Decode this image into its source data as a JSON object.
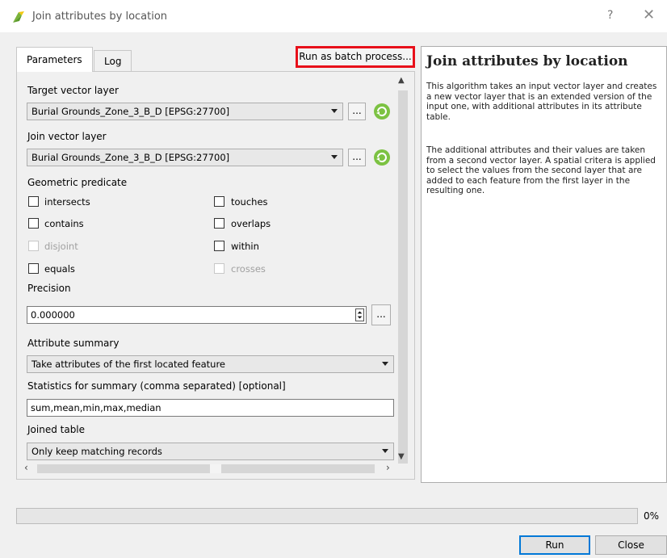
{
  "window": {
    "title": "Join attributes by location",
    "help_glyph": "?",
    "close_glyph": "✕"
  },
  "tabs": [
    {
      "label": "Parameters"
    },
    {
      "label": "Log"
    }
  ],
  "batch_button": "Run as batch process...",
  "params": {
    "target_label": "Target vector layer",
    "target_value": "Burial Grounds_Zone_3_B_D [EPSG:27700]",
    "join_label": "Join vector layer",
    "join_value": "Burial Grounds_Zone_3_B_D [EPSG:27700]",
    "browse": "...",
    "predicate_label": "Geometric predicate",
    "predicates": [
      {
        "label": "intersects",
        "checked": false,
        "enabled": true
      },
      {
        "label": "touches",
        "checked": false,
        "enabled": true
      },
      {
        "label": "contains",
        "checked": false,
        "enabled": true
      },
      {
        "label": "overlaps",
        "checked": false,
        "enabled": true
      },
      {
        "label": "disjoint",
        "checked": false,
        "enabled": false
      },
      {
        "label": "within",
        "checked": false,
        "enabled": true
      },
      {
        "label": "equals",
        "checked": false,
        "enabled": true
      },
      {
        "label": "crosses",
        "checked": false,
        "enabled": false
      }
    ],
    "precision_label": "Precision",
    "precision_value": "0.000000",
    "summary_label": "Attribute summary",
    "summary_value": "Take attributes of the first located feature",
    "stats_label": "Statistics for summary (comma separated) [optional]",
    "stats_value": "sum,mean,min,max,median",
    "joined_label": "Joined table",
    "joined_value": "Only keep matching records"
  },
  "help": {
    "title": "Join attributes by location",
    "para1": "This algorithm takes an input vector layer and creates a new vector layer that is an extended version of the input one, with additional attributes in its attribute table.",
    "para2": "The additional attributes and their values are taken from a second vector layer. A spatial critera is applied to select the values from the second layer that are added to each feature from the first layer in the resulting one."
  },
  "progress": {
    "value": 0,
    "label": "0%"
  },
  "buttons": {
    "run": "Run",
    "close": "Close"
  },
  "colors": {
    "highlight": "#e8101a",
    "default_button": "#0078d7",
    "progress": "#06b025"
  }
}
